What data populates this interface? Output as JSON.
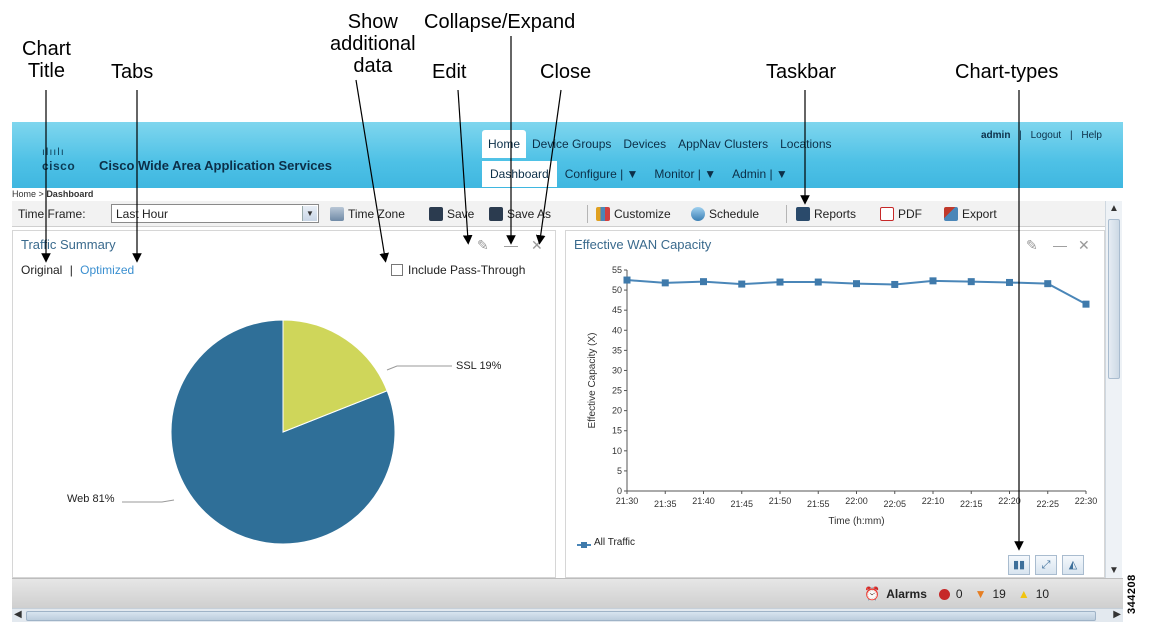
{
  "callouts": {
    "chart_title": [
      "Chart",
      "Title"
    ],
    "tabs": "Tabs",
    "show_additional_data": [
      "Show",
      "additional",
      "data"
    ],
    "edit": "Edit",
    "collapse_expand": "Collapse/Expand",
    "close": "Close",
    "taskbar": "Taskbar",
    "chart_types": "Chart-types"
  },
  "header": {
    "logo_bars": "ılıılı",
    "logo_text": "cisco",
    "app_title": "Cisco Wide Area Application Services",
    "nav_top": [
      "Home",
      "Device Groups",
      "Devices",
      "AppNav Clusters",
      "Locations"
    ],
    "nav_sub": [
      "Dashboard",
      "Configure | ▼",
      "Monitor | ▼",
      "Admin | ▼"
    ],
    "user": "admin",
    "logout": "Logout",
    "help": "Help"
  },
  "breadcrumb": {
    "home": "Home",
    "separator": ">",
    "current": "Dashboard"
  },
  "toolbar": {
    "time_frame_label": "Time Frame:",
    "time_frame_value": "Last Hour",
    "time_zone": "Time Zone",
    "save": "Save",
    "save_as": "Save As",
    "customize": "Customize",
    "schedule": "Schedule",
    "reports": "Reports",
    "pdf": "PDF",
    "export": "Export"
  },
  "traffic_panel": {
    "title": "Traffic Summary",
    "tab_original": "Original",
    "tab_separator": "|",
    "tab_optimized": "Optimized",
    "pass_through": "Include Pass-Through",
    "edit_icon": "✎",
    "collapse_icon": "—",
    "close_icon": "✕"
  },
  "wan_panel": {
    "title": "Effective WAN Capacity",
    "legend": "All Traffic",
    "edit_icon": "✎",
    "collapse_icon": "—",
    "close_icon": "✕"
  },
  "status": {
    "alarms_label": "Alarms",
    "critical": "0",
    "major": "19",
    "minor": "10"
  },
  "figure_id": "344208",
  "colors": {
    "pie_web": "#2f6f98",
    "pie_ssl": "#cfd65a",
    "line": "#4a86b8",
    "accent": "#3a8fd0"
  },
  "chart_data": [
    {
      "type": "pie",
      "title": "Traffic Summary",
      "labels": [
        "Web 81%",
        "SSL 19%"
      ],
      "values": [
        81,
        19
      ]
    },
    {
      "type": "line",
      "title": "Effective WAN Capacity",
      "xlabel": "Time (h:mm)",
      "ylabel": "Effective Capacity (X)",
      "ylim": [
        0,
        55
      ],
      "yticks": [
        0,
        5,
        10,
        15,
        20,
        25,
        30,
        35,
        40,
        45,
        50,
        55
      ],
      "x": [
        "21:30",
        "21:35",
        "21:40",
        "21:45",
        "21:50",
        "21:55",
        "22:00",
        "22:05",
        "22:10",
        "22:15",
        "22:20",
        "22:25",
        "22:30"
      ],
      "series": [
        {
          "name": "All Traffic",
          "values": [
            52.5,
            51.8,
            52.1,
            51.5,
            52.0,
            52.0,
            51.6,
            51.4,
            52.3,
            52.1,
            51.9,
            51.6,
            46.5
          ]
        }
      ],
      "grid": false,
      "legend": "bottom-left"
    }
  ]
}
